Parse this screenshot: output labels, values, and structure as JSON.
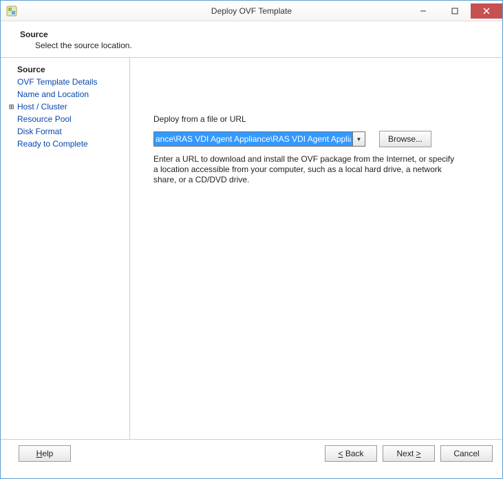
{
  "window": {
    "title": "Deploy OVF Template"
  },
  "header": {
    "title": "Source",
    "subtitle": "Select the source location."
  },
  "sidebar": {
    "items": [
      {
        "label": "Source",
        "active": true,
        "expandable": false
      },
      {
        "label": "OVF Template Details",
        "active": false,
        "expandable": false
      },
      {
        "label": "Name and Location",
        "active": false,
        "expandable": false
      },
      {
        "label": "Host / Cluster",
        "active": false,
        "expandable": true
      },
      {
        "label": "Resource Pool",
        "active": false,
        "expandable": false
      },
      {
        "label": "Disk Format",
        "active": false,
        "expandable": false
      },
      {
        "label": "Ready to Complete",
        "active": false,
        "expandable": false
      }
    ]
  },
  "main": {
    "field_label": "Deploy from a file or URL",
    "path_value": "ance\\RAS VDI Agent Appliance\\RAS VDI Agent Appliance.ovf",
    "browse_label": "Browse...",
    "helper_text": "Enter a URL to download and install the OVF package from the Internet, or specify a location accessible from your computer, such as a local hard drive, a network share, or a CD/DVD drive."
  },
  "footer": {
    "help": "Help",
    "back": "< Back",
    "next": "Next >",
    "cancel": "Cancel"
  }
}
